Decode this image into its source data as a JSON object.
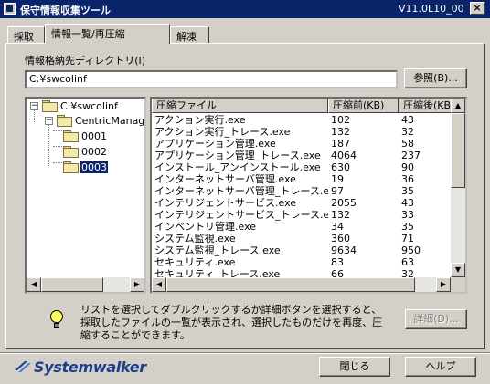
{
  "window": {
    "title": "保守情報収集ツール",
    "version": "V11.0L10_00",
    "close_label": "×"
  },
  "tabs": [
    {
      "label": "採取"
    },
    {
      "label": "情報一覧/再圧縮"
    },
    {
      "label": "解凍"
    }
  ],
  "directory": {
    "label": "情報格納先ディレクトリ(I)",
    "value": "C:¥swcolinf",
    "browse_label": "参照(B)..."
  },
  "tree": {
    "root": "C:¥swcolinf",
    "child": "CentricManager",
    "items": [
      "0001",
      "0002",
      "0003"
    ],
    "selected": "0003"
  },
  "list": {
    "columns": [
      "圧縮ファイル",
      "圧縮前(KB)",
      "圧縮後(KB)"
    ],
    "rows": [
      [
        "アクション実行.exe",
        "102",
        "43"
      ],
      [
        "アクション実行_トレース.exe",
        "132",
        "32"
      ],
      [
        "アプリケーション管理.exe",
        "187",
        "58"
      ],
      [
        "アプリケーション管理_トレース.exe",
        "4064",
        "237"
      ],
      [
        "インストール_アンインストール.exe",
        "630",
        "90"
      ],
      [
        "インターネットサーバ管理.exe",
        "19",
        "36"
      ],
      [
        "インターネットサーバ管理_トレース.exe",
        "97",
        "35"
      ],
      [
        "インテリジェントサービス.exe",
        "2055",
        "43"
      ],
      [
        "インテリジェントサービス_トレース.exe",
        "132",
        "33"
      ],
      [
        "インベントリ管理.exe",
        "34",
        "35"
      ],
      [
        "システム監視.exe",
        "360",
        "71"
      ],
      [
        "システム監視_トレース.exe",
        "9634",
        "950"
      ],
      [
        "セキュリティ.exe",
        "83",
        "63"
      ],
      [
        "セキュリティ_トレース.exe",
        "66",
        "32"
      ]
    ]
  },
  "info": {
    "text": "リストを選択してダブルクリックするか詳細ボタンを選択すると、採取したファイルの一覧が表示され、選択したものだけを再度、圧縮することができます。",
    "details_label": "詳細(D)..."
  },
  "footer": {
    "logo_text": "Systemwalker",
    "close_label": "閉じる",
    "help_label": "ヘルプ"
  },
  "colors": {
    "titlebar": "#0a246a",
    "face": "#d4d0c8",
    "logo": "#1e3c8c"
  }
}
